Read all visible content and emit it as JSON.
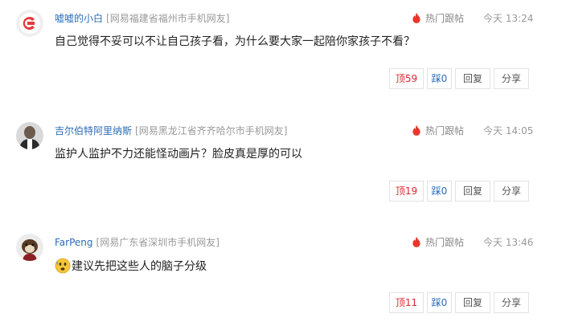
{
  "hot_label": "热门跟帖",
  "comments": [
    {
      "username": "嘘嘘的小白",
      "location": "[网易福建省福州市手机网友]",
      "time": "今天 13:24",
      "content": "自己觉得不妥可以不让自己孩子看，为什么要大家一起陪你家孩子不看？",
      "up_label": "顶59",
      "down_label": "踩0",
      "reply_label": "回复",
      "share_label": "分享"
    },
    {
      "username": "吉尔伯特阿里纳斯",
      "location": "[网易黑龙江省齐齐哈尔市手机网友]",
      "time": "今天 14:05",
      "content": "监护人监护不力还能怪动画片？脸皮真是厚的可以",
      "up_label": "顶19",
      "down_label": "踩0",
      "reply_label": "回复",
      "share_label": "分享"
    },
    {
      "username": "FarPeng",
      "location": "[网易广东省深圳市手机网友]",
      "time": "今天 13:46",
      "content": "建议先把这些人的脑子分级",
      "up_label": "顶11",
      "down_label": "踩0",
      "reply_label": "回复",
      "share_label": "分享"
    }
  ],
  "colors": {
    "username": "#2a6bb8",
    "up": "#d9272d",
    "down": "#2a6bb8",
    "hot_flame": "#e8362c"
  }
}
